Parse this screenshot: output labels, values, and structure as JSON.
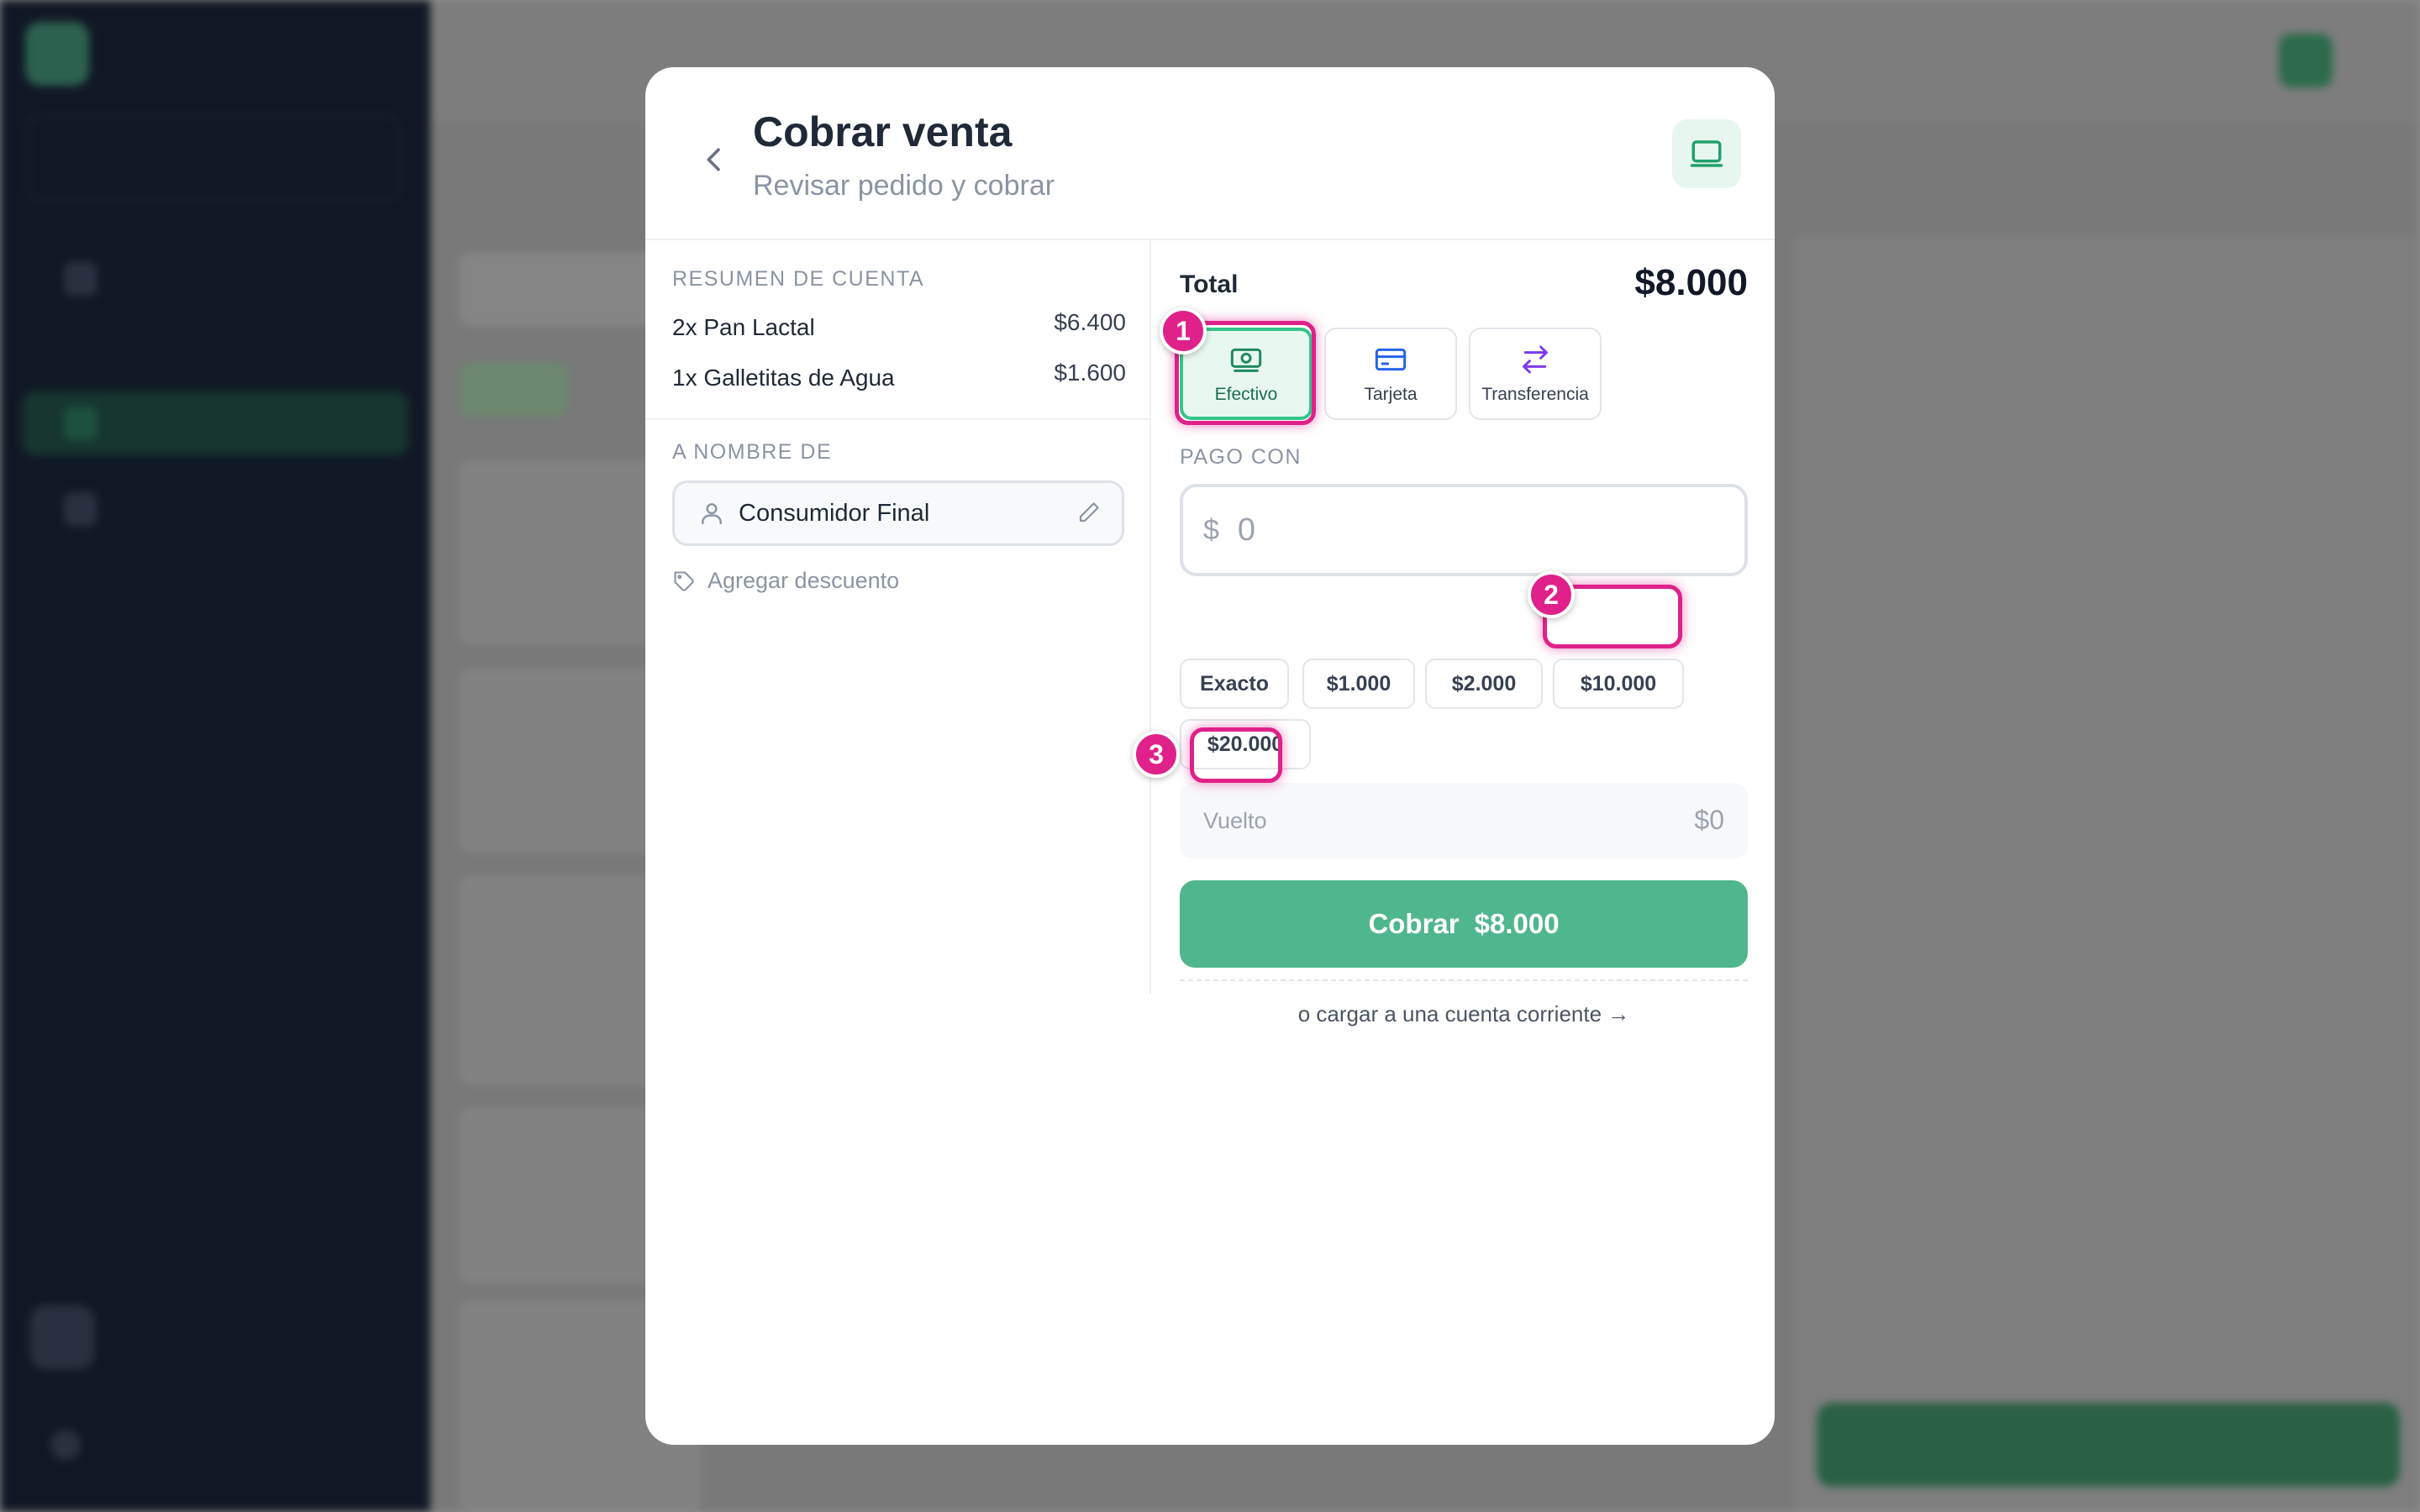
{
  "modal": {
    "title": "Cobrar venta",
    "subtitle": "Revisar pedido y cobrar",
    "summary": {
      "label": "RESUMEN DE CUENTA",
      "items": [
        {
          "name": "2x Pan Lactal",
          "price": "$6.400"
        },
        {
          "name": "1x Galletitas de Agua",
          "price": "$1.600"
        }
      ]
    },
    "customer": {
      "label": "A NOMBRE DE",
      "value": "Consumidor Final"
    },
    "discount_link": "Agregar descuento",
    "total": {
      "label": "Total",
      "value": "$8.000"
    },
    "methods": [
      {
        "label": "Efectivo",
        "icon": "cash-icon",
        "selected": true
      },
      {
        "label": "Tarjeta",
        "icon": "card-icon",
        "selected": false
      },
      {
        "label": "Transferencia",
        "icon": "transfer-icon",
        "selected": false
      }
    ],
    "payment": {
      "label": "PAGO CON",
      "currency": "$",
      "placeholder": "0"
    },
    "quick_amounts": [
      "Exacto",
      "$1.000",
      "$2.000",
      "$10.000",
      "$20.000"
    ],
    "change": {
      "label": "Vuelto",
      "value": "$0"
    },
    "submit": {
      "label": "Cobrar",
      "amount": "$8.000"
    },
    "account_link": "o cargar a una cuenta corriente →"
  },
  "annotations": [
    "1",
    "2",
    "3"
  ],
  "colors": {
    "accent": "#50b68d",
    "selected_bg": "#e8f8f0",
    "highlight": "#e0218a"
  }
}
